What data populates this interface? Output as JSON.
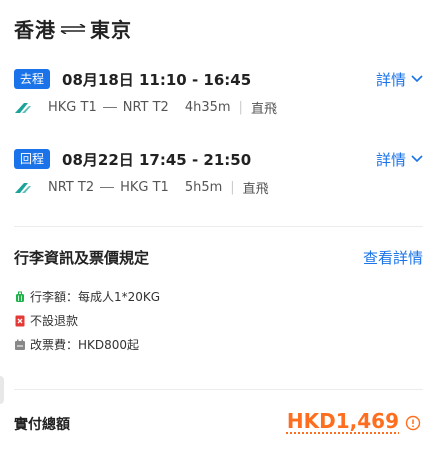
{
  "route": {
    "origin": "香港",
    "destination": "東京"
  },
  "segments": [
    {
      "badge": "去程",
      "date_time": "08月18日 11:10 - 16:45",
      "details_label": "詳情",
      "from": "HKG T1",
      "to": "NRT T2",
      "duration": "4h35m",
      "separator": "|",
      "stops": "直飛"
    },
    {
      "badge": "回程",
      "date_time": "08月22日 17:45 - 21:50",
      "details_label": "詳情",
      "from": "NRT T2",
      "to": "HKG T1",
      "duration": "5h5m",
      "separator": "|",
      "stops": "直飛"
    }
  ],
  "policy": {
    "title": "行李資訊及票價規定",
    "link": "查看詳情",
    "items": [
      {
        "icon": "luggage-icon",
        "text": "行李額：每成人1*20KG",
        "color": "#1fb24a"
      },
      {
        "icon": "no-refund-icon",
        "text": "不設退款",
        "color": "#e53935"
      },
      {
        "icon": "change-fee-icon",
        "text": "改票費：HKD800起",
        "color": "#888888"
      }
    ]
  },
  "total": {
    "label": "實付總額",
    "price": "HKD1,469"
  },
  "colors": {
    "accent": "#1a73e8",
    "price": "#ff6e1f",
    "airline": "#1aa39a"
  }
}
